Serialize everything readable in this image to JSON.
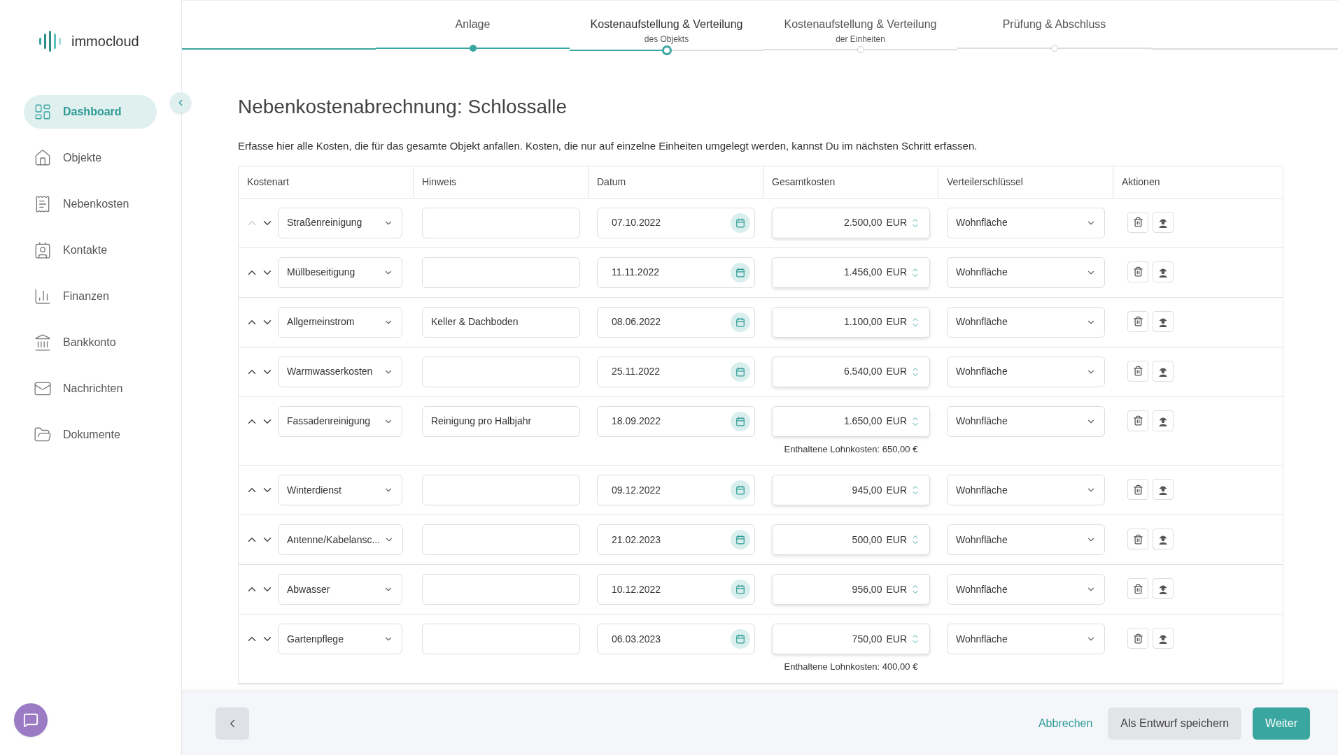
{
  "logo": {
    "text": "immocloud"
  },
  "sidebar": {
    "items": [
      {
        "label": "Dashboard",
        "kind": "dashboard",
        "selected": true
      },
      {
        "label": "Objekte",
        "kind": "home",
        "selected": false
      },
      {
        "label": "Nebenkosten",
        "kind": "costs",
        "selected": false
      },
      {
        "label": "Kontakte",
        "kind": "contacts",
        "selected": false
      },
      {
        "label": "Finanzen",
        "kind": "chart",
        "selected": false
      },
      {
        "label": "Bankkonto",
        "kind": "bank",
        "selected": false
      },
      {
        "label": "Nachrichten",
        "kind": "mail",
        "selected": false
      },
      {
        "label": "Dokumente",
        "kind": "docs",
        "selected": false
      }
    ]
  },
  "steps": [
    {
      "title": "Anlage",
      "completed": true,
      "selected": false
    },
    {
      "title": "Kostenaufstellung & Verteilung",
      "subtitle": "des Objekts",
      "completed": false,
      "selected": true
    },
    {
      "title": "Kostenaufstellung & Verteilung",
      "subtitle": "der Einheiten",
      "completed": false,
      "selected": false
    },
    {
      "title": "Prüfung & Abschluss",
      "completed": false,
      "selected": false
    }
  ],
  "page": {
    "title": "Nebenkostenabrechnung: Schlossalle",
    "intro": "Erfasse hier alle Kosten, die für das gesamte Objekt anfallen. Kosten, die nur auf einzelne Einheiten umgelegt werden, kannst Du im nächsten Schritt erfassen."
  },
  "table": {
    "columns": [
      "Kostenart",
      "Hinweis",
      "Datum",
      "Gesamtkosten",
      "Verteilerschlüssel",
      "Aktionen"
    ],
    "rows": [
      {
        "cost_type": "Straßenreinigung",
        "move_up_disabled": true,
        "note": "",
        "date": "07.10.2022",
        "amount": "2.500,00",
        "currency": "EUR",
        "key": "Wohnfläche"
      },
      {
        "cost_type": "Müllbeseitigung",
        "move_up_disabled": false,
        "note": "",
        "date": "11.11.2022",
        "amount": "1.456,00",
        "currency": "EUR",
        "key": "Wohnfläche"
      },
      {
        "cost_type": "Allgemeinstrom",
        "move_up_disabled": false,
        "note": "Keller & Dachboden",
        "date": "08.06.2022",
        "amount": "1.100,00",
        "currency": "EUR",
        "key": "Wohnfläche"
      },
      {
        "cost_type": "Warmwasserkosten",
        "move_up_disabled": false,
        "note": "",
        "date": "25.11.2022",
        "amount": "6.540,00",
        "currency": "EUR",
        "key": "Wohnfläche"
      },
      {
        "cost_type": "Fassadenreinigung",
        "move_up_disabled": false,
        "note": "Reinigung pro Halbjahr",
        "date": "18.09.2022",
        "amount": "1.650,00",
        "currency": "EUR",
        "key": "Wohnfläche",
        "labor_note": "Enthaltene Lohnkosten: 650,00 €"
      },
      {
        "cost_type": "Winterdienst",
        "move_up_disabled": false,
        "note": "",
        "date": "09.12.2022",
        "amount": "945,00",
        "currency": "EUR",
        "key": "Wohnfläche"
      },
      {
        "cost_type": "Antenne/Kabelansc...",
        "move_up_disabled": false,
        "note": "",
        "date": "21.02.2023",
        "amount": "500,00",
        "currency": "EUR",
        "key": "Wohnfläche"
      },
      {
        "cost_type": "Abwasser",
        "move_up_disabled": false,
        "note": "",
        "date": "10.12.2022",
        "amount": "956,00",
        "currency": "EUR",
        "key": "Wohnfläche"
      },
      {
        "cost_type": "Gartenpflege",
        "move_up_disabled": false,
        "note": "",
        "date": "06.03.2023",
        "amount": "750,00",
        "currency": "EUR",
        "key": "Wohnfläche",
        "labor_note": "Enthaltene Lohnkosten: 400,00 €"
      }
    ]
  },
  "footer": {
    "cancel": "Abbrechen",
    "save_draft": "Als Entwurf speichern",
    "next": "Weiter"
  }
}
